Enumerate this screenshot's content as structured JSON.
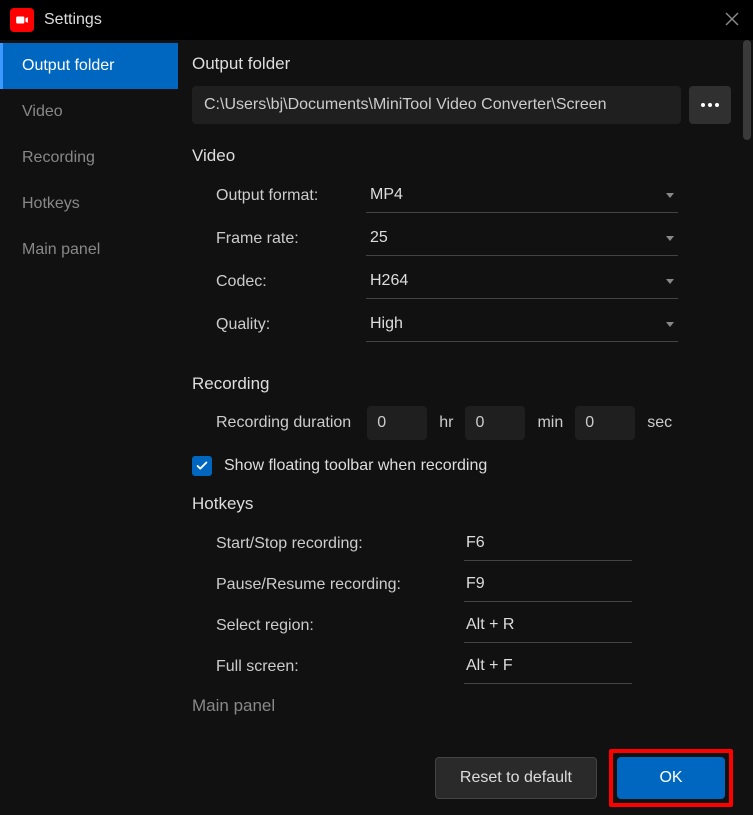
{
  "window": {
    "title": "Settings"
  },
  "sidebar": {
    "items": [
      {
        "label": "Output folder"
      },
      {
        "label": "Video"
      },
      {
        "label": "Recording"
      },
      {
        "label": "Hotkeys"
      },
      {
        "label": "Main panel"
      }
    ]
  },
  "output_folder": {
    "header": "Output folder",
    "path": "C:\\Users\\bj\\Documents\\MiniTool Video Converter\\Screen"
  },
  "video": {
    "header": "Video",
    "output_format_label": "Output format:",
    "output_format_value": "MP4",
    "frame_rate_label": "Frame rate:",
    "frame_rate_value": "25",
    "codec_label": "Codec:",
    "codec_value": "H264",
    "quality_label": "Quality:",
    "quality_value": "High"
  },
  "recording": {
    "header": "Recording",
    "duration_label": "Recording duration",
    "hr_value": "0",
    "hr_unit": "hr",
    "min_value": "0",
    "min_unit": "min",
    "sec_value": "0",
    "sec_unit": "sec",
    "toolbar_checkbox_label": "Show floating toolbar when recording",
    "toolbar_checked": true
  },
  "hotkeys": {
    "header": "Hotkeys",
    "start_stop_label": "Start/Stop recording:",
    "start_stop_value": "F6",
    "pause_resume_label": "Pause/Resume recording:",
    "pause_resume_value": "F9",
    "select_region_label": "Select region:",
    "select_region_value": "Alt + R",
    "full_screen_label": "Full screen:",
    "full_screen_value": "Alt + F"
  },
  "main_panel": {
    "header": "Main panel"
  },
  "footer": {
    "reset_label": "Reset to default",
    "ok_label": "OK"
  }
}
